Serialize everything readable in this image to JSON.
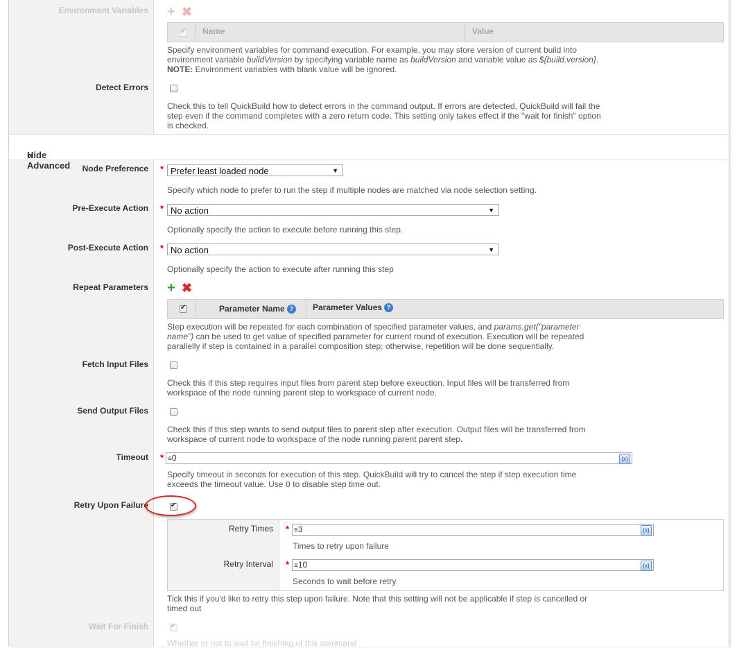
{
  "env": {
    "label": "Environment Variables",
    "col_name": "Name",
    "col_value": "Value",
    "help_line1": "Specify environment variables for command execution. For example, you may store version of current build into",
    "help_line2_a": "environment variable ",
    "help_line2_b": "buildVersion",
    "help_line2_c": " by specifying variable name as ",
    "help_line2_d": "buildVersion",
    "help_line2_e": " and variable value as ",
    "help_line2_f": "${build.version}",
    "help_line2_g": ".",
    "note_label": "NOTE:",
    "note_text": " Environment variables with blank value will be ignored."
  },
  "detect_errors": {
    "label": "Detect Errors",
    "checked": false,
    "help_line1": "Check this to tell QuickBuild how to detect errors in the command output. If errors are detected, QuickBuild will fail the",
    "help_line2": "step even if the command completes with a zero return code. This setting only takes effect if the \"wait for finish\" option",
    "help_line3": "is checked."
  },
  "advanced": {
    "label": "Hide Advanced",
    "icon": "«"
  },
  "node_pref": {
    "label": "Node Preference",
    "value": "Prefer least loaded node",
    "help": "Specify which node to prefer to run the step if multiple nodes are matched via node selection setting."
  },
  "pre_action": {
    "label": "Pre-Execute Action",
    "value": "No action",
    "help": "Optionally specify the action to execute before running this step."
  },
  "post_action": {
    "label": "Post-Execute Action",
    "value": "No action",
    "help": "Optionally specify the action to execute after running this step"
  },
  "repeat": {
    "label": "Repeat Parameters",
    "col_name": "Parameter Name",
    "col_values": "Parameter Values",
    "help_q": "?",
    "help_line1_a": "Step execution will be repeated for each combination of specified parameter values, and ",
    "help_line1_b": "params.get(\"parameter",
    "help_line2_a": "name\")",
    "help_line2_b": " can be used to get value of specified parameter for current round of execution. Execution will be repeated",
    "help_line3": "parallelly if step is contained in a parallel composition step; otherwise, repetition will be done sequentially."
  },
  "fetch_input": {
    "label": "Fetch Input Files",
    "checked": false,
    "help_line1": "Check this if this step requires input files from parent step before exeuction. Input files will be transferred from",
    "help_line2": "workspace of the node running parent step to workspace of current node."
  },
  "send_output": {
    "label": "Send Output Files",
    "checked": false,
    "help_line1": "Check this if this step wants to send output files to parent step after execution. Output files will be transferred from",
    "help_line2": "workspace of current node to workspace of the node running parent parent step."
  },
  "timeout": {
    "label": "Timeout",
    "value": "0",
    "help_line1": "Specify timeout in seconds for execution of this step. QuickBuild will try to cancel the step if step execution time",
    "help_line2_a": "exceeds the timeout value. Use ",
    "help_line2_b": "0",
    "help_line2_c": " to disable step time out."
  },
  "retry": {
    "label": "Retry Upon Failure",
    "checked": true,
    "times_label": "Retry Times",
    "times_value": "3",
    "times_help": "Times to retry upon failure",
    "interval_label": "Retry Interval",
    "interval_value": "10",
    "interval_help": "Seconds to wait before retry",
    "help_line1": "Tick this if you'd like to retry this step upon failure. Note that this setting will not be applicable if step is cancelled or",
    "help_line2": "timed out"
  },
  "wait_finish": {
    "label": "Wait For Finish",
    "checked": true,
    "help": "Whether or not to wait for finishing of this command"
  },
  "common": {
    "required": "*",
    "expr_icon": "{x}",
    "value_prefix": "≡"
  },
  "colors": {
    "accent": "#3a7fcc",
    "required": "#dd0000",
    "highlight_circle": "#dd2222"
  }
}
